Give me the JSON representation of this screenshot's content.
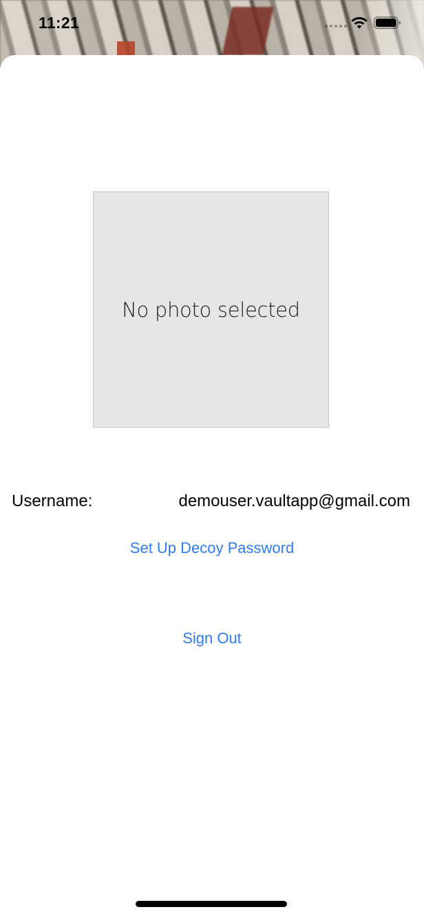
{
  "status_bar": {
    "time": "11:21",
    "icons": [
      "wifi-icon",
      "battery-icon"
    ]
  },
  "photo": {
    "placeholder_text": "No photo selected"
  },
  "account": {
    "username_label": "Username:",
    "username_value": "demouser.vaultapp@gmail.com"
  },
  "actions": {
    "decoy_label": "Set Up Decoy Password",
    "signout_label": "Sign Out"
  },
  "colors": {
    "link": "#2f7cf6",
    "photo_background": "#e6e6e6",
    "sheet_background": "#ffffff"
  }
}
